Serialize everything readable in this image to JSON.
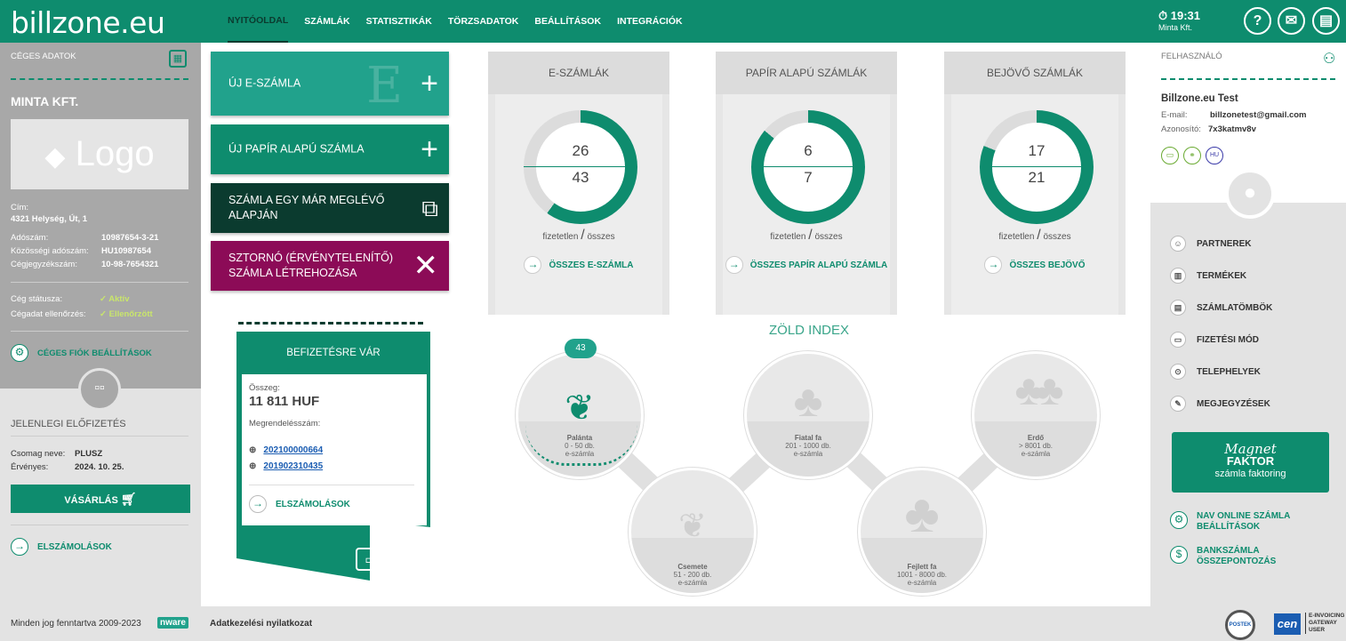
{
  "header": {
    "logo": "billzone.eu",
    "nav": [
      "NYITÓOLDAL",
      "SZÁMLÁK",
      "STATISZTIKÁK",
      "TÖRZSADATOK",
      "BEÁLLÍTÁSOK",
      "INTEGRÁCIÓK"
    ],
    "time": "19:31",
    "company": "Minta Kft."
  },
  "left": {
    "section_title": "CÉGES ADATOK",
    "company_name": "MINTA KFT.",
    "logo_placeholder": "Logo",
    "address_label": "Cím:",
    "address": "4321 Helység, Út, 1",
    "fields": [
      {
        "label": "Adószám:",
        "value": "10987654-3-21"
      },
      {
        "label": "Közösségi adószám:",
        "value": "HU10987654"
      },
      {
        "label": "Cégjegyzékszám:",
        "value": "10-98-7654321"
      }
    ],
    "status_label": "Cég státusza:",
    "status_value": "Aktív",
    "check_label": "Cégadat ellenőrzés:",
    "check_value": "Ellenőrzött",
    "settings_link": "CÉGES FIÓK BEÁLLÍTÁSOK",
    "subscription_title": "JELENLEGI ELŐFIZETÉS",
    "package_label": "Csomag neve:",
    "package_value": "PLUSZ",
    "valid_label": "Érvényes:",
    "valid_value": "2024. 10. 25.",
    "buy_button": "VÁSÁRLÁS",
    "billing_link": "ELSZÁMOLÁSOK"
  },
  "actions": [
    {
      "label": "ÚJ E-SZÁMLA",
      "color": "#21a28c"
    },
    {
      "label": "ÚJ PAPÍR ALAPÚ SZÁMLA",
      "color": "#0e8c6e"
    },
    {
      "label": "SZÁMLA EGY MÁR MEGLÉVŐ ALAPJÁN",
      "color": "#0b3b2f"
    },
    {
      "label": "SZTORNÓ (ÉRVÉNYTELENÍTŐ) SZÁMLA LÉTREHOZÁSA",
      "color": "#8c0b57"
    }
  ],
  "payment": {
    "title": "BEFIZETÉSRE VÁR",
    "amount_label": "Összeg:",
    "amount": "11 811 HUF",
    "order_label": "Megrendelésszám:",
    "orders": [
      "202100000664",
      "201902310435"
    ],
    "link": "ELSZÁMOLÁSOK"
  },
  "cards": [
    {
      "title": "E-SZÁMLÁK",
      "unpaid": "26",
      "total": "43",
      "fraction": 0.6,
      "unpaid_label": "fizetetlen",
      "total_label": "összes",
      "link": "ÖSSZES E-SZÁMLA"
    },
    {
      "title": "PAPÍR ALAPÚ SZÁMLÁK",
      "unpaid": "6",
      "total": "7",
      "fraction": 0.86,
      "unpaid_label": "fizetetlen",
      "total_label": "összes",
      "link": "ÖSSZES PAPÍR ALAPÚ SZÁMLA"
    },
    {
      "title": "BEJÖVŐ SZÁMLÁK",
      "unpaid": "17",
      "total": "21",
      "fraction": 0.81,
      "unpaid_label": "fizetetlen",
      "total_label": "összes",
      "link": "ÖSSZES BEJÖVŐ"
    }
  ],
  "green_index": {
    "title": "ZÖLD INDEX",
    "badge": "43",
    "stages": [
      {
        "name": "Palánta",
        "range": "0 - 50 db.",
        "unit": "e-számla"
      },
      {
        "name": "Csemete",
        "range": "51 - 200 db.",
        "unit": "e-számla"
      },
      {
        "name": "Fiatal fa",
        "range": "201 - 1000 db.",
        "unit": "e-számla"
      },
      {
        "name": "Fejlett fa",
        "range": "1001 - 8000 db.",
        "unit": "e-számla"
      },
      {
        "name": "Erdő",
        "range": "> 8001 db.",
        "unit": "e-számla"
      }
    ]
  },
  "right": {
    "section_title": "FELHASZNÁLÓ",
    "user_name": "Billzone.eu Test",
    "email_label": "E-mail:",
    "email": "billzonetest@gmail.com",
    "id_label": "Azonosító:",
    "id": "7x3katmv8v",
    "lang": "HU",
    "menu": [
      "PARTNEREK",
      "TERMÉKEK",
      "SZÁMLATÖMBÖK",
      "FIZETÉSI MÓD",
      "TELEPHELYEK",
      "MEGJEGYZÉSEK"
    ],
    "magnet_title": "Magnet",
    "magnet_sub": "FAKTOR",
    "magnet_desc": "számla faktoring",
    "link1": "NAV ONLINE SZÁMLA BEÁLLÍTÁSOK",
    "link2": "BANKSZÁMLA ÖSSZEPONTOZÁS"
  },
  "footer": {
    "copyright": "Minden jog fenntartva 2009-2023",
    "brand": "nware",
    "privacy": "Adatkezelési nyilatkozat",
    "badge1": "POSTEK",
    "badge2_logo": "cen",
    "badge2_text": "E-INVOICING GATEWAY USER"
  },
  "colors": {
    "primary": "#0e8c6e",
    "accent": "#21a28c",
    "dark": "#0b3b2f",
    "storno": "#8c0b57",
    "lime": "#a8d86b"
  }
}
